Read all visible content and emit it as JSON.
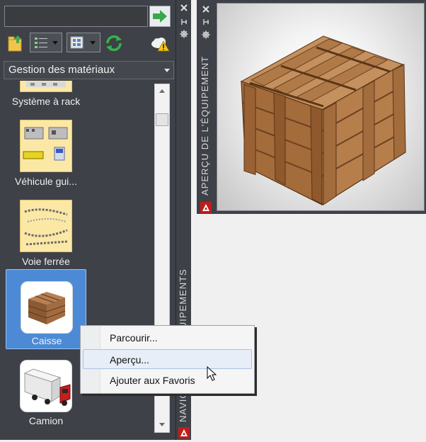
{
  "palette": {
    "category": "Gestion des matériaux",
    "items": [
      {
        "label": "Système à rack"
      },
      {
        "label": "Véhicule gui..."
      },
      {
        "label": "Voie ferrée"
      },
      {
        "label": "Caisse"
      },
      {
        "label": "Camion"
      }
    ]
  },
  "side_strip": {
    "title": "NAVIGATEUR D'ÉQUIPEMENTS"
  },
  "preview": {
    "title": "APERÇU DE L'ÉQUIPEMENT"
  },
  "context_menu": {
    "items": [
      {
        "label": "Parcourir..."
      },
      {
        "label": "Aperçu..."
      },
      {
        "label": "Ajouter aux Favoris"
      }
    ]
  },
  "colors": {
    "panel": "#3e4147",
    "selection": "#4c8ad6",
    "accent_red": "#c01c1c"
  }
}
